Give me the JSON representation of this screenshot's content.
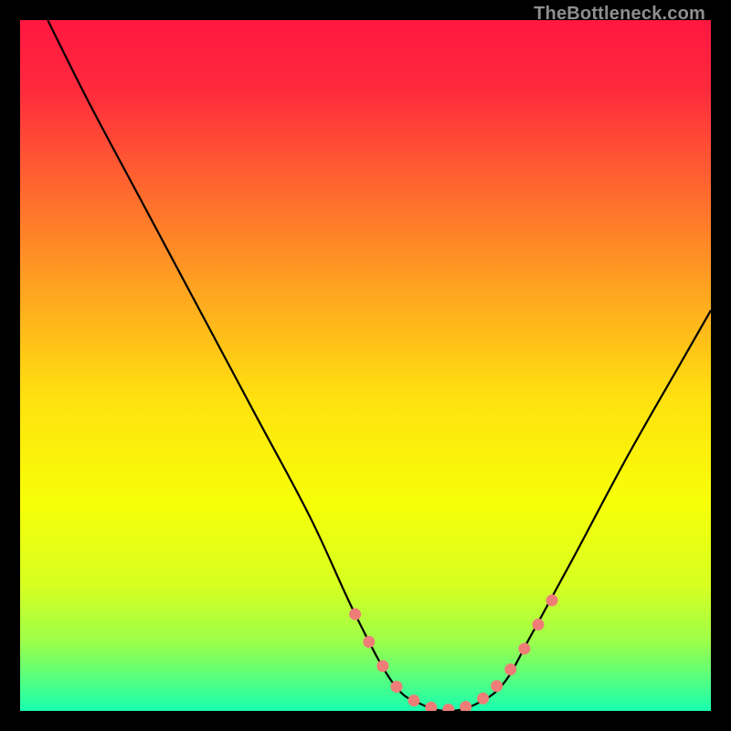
{
  "watermark": "TheBottleneck.com",
  "chart_data": {
    "type": "line",
    "title": "",
    "xlabel": "",
    "ylabel": "",
    "xlim": [
      0,
      100
    ],
    "ylim": [
      0,
      100
    ],
    "background": {
      "type": "vertical-gradient",
      "stops": [
        {
          "offset": 0.0,
          "color": "#ff1740"
        },
        {
          "offset": 0.1,
          "color": "#ff2a3d"
        },
        {
          "offset": 0.25,
          "color": "#ff6a2e"
        },
        {
          "offset": 0.4,
          "color": "#ffa81f"
        },
        {
          "offset": 0.55,
          "color": "#ffe20f"
        },
        {
          "offset": 0.7,
          "color": "#f7ff08"
        },
        {
          "offset": 0.82,
          "color": "#d6ff22"
        },
        {
          "offset": 0.9,
          "color": "#9cff4a"
        },
        {
          "offset": 0.96,
          "color": "#4dff86"
        },
        {
          "offset": 1.0,
          "color": "#18ffb0"
        }
      ]
    },
    "series": [
      {
        "name": "bottleneck-curve",
        "color": "#000000",
        "x": [
          4,
          10,
          18,
          26,
          34,
          42,
          48.5,
          54,
          58,
          62,
          66,
          70,
          74,
          80,
          88,
          96,
          100
        ],
        "y": [
          100,
          88,
          73,
          58,
          43,
          28,
          14,
          4,
          1,
          0,
          1,
          4,
          11,
          22,
          37,
          51,
          58
        ]
      }
    ],
    "markers": {
      "name": "highlight-dots",
      "color": "#ef7d77",
      "radius": 6.5,
      "points": [
        {
          "x": 48.5,
          "y": 14.0
        },
        {
          "x": 50.5,
          "y": 10.0
        },
        {
          "x": 52.5,
          "y": 6.5
        },
        {
          "x": 54.5,
          "y": 3.5
        },
        {
          "x": 57.0,
          "y": 1.5
        },
        {
          "x": 59.5,
          "y": 0.5
        },
        {
          "x": 62.0,
          "y": 0.2
        },
        {
          "x": 64.5,
          "y": 0.6
        },
        {
          "x": 67.0,
          "y": 1.8
        },
        {
          "x": 69.0,
          "y": 3.6
        },
        {
          "x": 71.0,
          "y": 6.0
        },
        {
          "x": 73.0,
          "y": 9.0
        },
        {
          "x": 75.0,
          "y": 12.5
        },
        {
          "x": 77.0,
          "y": 16.0
        }
      ]
    }
  }
}
